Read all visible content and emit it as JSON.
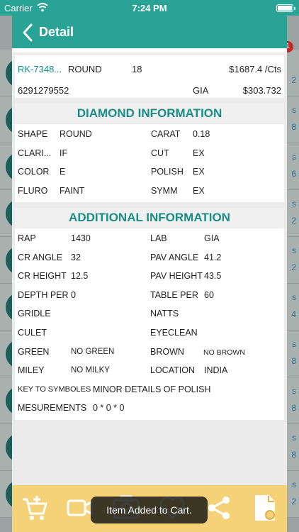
{
  "status_bar": {
    "carrier": "Carrier",
    "time": "7:24 PM"
  },
  "background": {
    "badge": "1",
    "rows": [
      {
        "right_top": "",
        "right_bottom": "2"
      },
      {
        "right_top": "s",
        "right_bottom": "8"
      },
      {
        "right_top": "s",
        "right_bottom": "6"
      },
      {
        "right_top": "s",
        "right_bottom": "2"
      },
      {
        "right_top": "s",
        "right_bottom": "2"
      },
      {
        "right_top": "s",
        "right_bottom": "4"
      },
      {
        "right_top": "s",
        "right_bottom": "8"
      },
      {
        "right_top": "s",
        "right_bottom": "8"
      },
      {
        "right_top": "s",
        "right_bottom": "8"
      },
      {
        "right_top": "s",
        "right_bottom": "2"
      }
    ]
  },
  "header": {
    "title": "Detail"
  },
  "summary": {
    "stock_id": "RK-7348...",
    "shape": "ROUND",
    "qty": "18",
    "price_per_ct": "$1687.4 /Cts",
    "certificate_no": "6291279552",
    "lab": "GIA",
    "amount": "$303.732"
  },
  "diamond_info": {
    "title": "DIAMOND INFORMATION",
    "rows": [
      {
        "l1": "SHAPE",
        "v1": "ROUND",
        "l2": "CARAT",
        "v2": "0.18"
      },
      {
        "l1": "CLARI...",
        "v1": "IF",
        "l2": "CUT",
        "v2": "EX"
      },
      {
        "l1": "COLOR",
        "v1": "E",
        "l2": "POLISH",
        "v2": "EX"
      },
      {
        "l1": "FLURO",
        "v1": "FAINT",
        "l2": "SYMM",
        "v2": "EX"
      }
    ]
  },
  "additional_info": {
    "title": "ADDITIONAL INFORMATION",
    "rows": [
      {
        "l1": "RAP",
        "v1": "1430",
        "l2": "LAB",
        "v2": "GIA"
      },
      {
        "l1": "CR ANGLE",
        "v1": "32",
        "l2": "PAV ANGLE",
        "v2": "41.2"
      },
      {
        "l1": "CR HEIGHT",
        "v1": "12.5",
        "l2": "PAV HEIGHT",
        "v2": "43.5"
      },
      {
        "l1": "DEPTH PER",
        "v1": "0",
        "l2": "TABLE PER",
        "v2": "60"
      },
      {
        "l1": "GRIDLE",
        "v1": "",
        "l2": "NATTS",
        "v2": ""
      },
      {
        "l1": "CULET",
        "v1": "",
        "l2": "EYECLEAN",
        "v2": ""
      },
      {
        "l1": "GREEN",
        "v1": "NO GREEN",
        "l2": "BROWN",
        "v2": "NO BROWN"
      },
      {
        "l1": "MILEY",
        "v1": "NO MILKY",
        "l2": "LOCATION",
        "v2": "INDIA"
      }
    ],
    "key_to_symbols_label": "KEY TO SYMBOLES",
    "key_to_symbols_value": "MINOR DETAILS OF POLISH",
    "measurements_label": "MESUREMENTS",
    "measurements_value": "0 * 0 * 0"
  },
  "toolbar": {
    "icons": [
      "add-to-cart-icon",
      "video-icon",
      "camera-icon",
      "heart-icon",
      "share-icon",
      "certificate-icon"
    ]
  },
  "toast": {
    "message": "Item Added to Cart."
  },
  "colors": {
    "primary": "#2aa397",
    "accent_text": "#1b8d84",
    "toolbar": "#f5d277",
    "icon": "#ffffff"
  }
}
